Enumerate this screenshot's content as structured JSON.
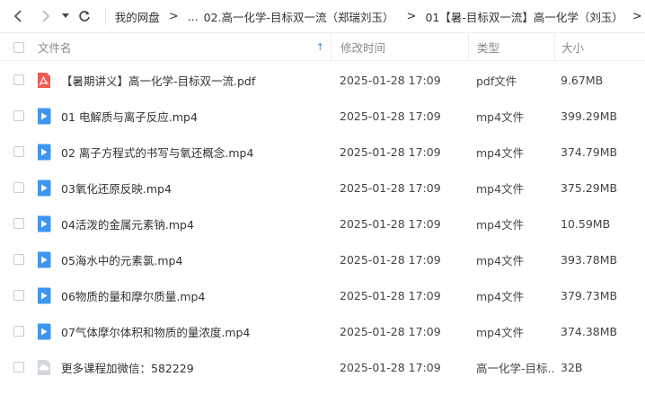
{
  "breadcrumb": [
    "我的网盘",
    "...",
    "02.高一化学-目标双一流（郑瑞刘玉）",
    "01【暑-目标双一流】高一化学（刘玉）"
  ],
  "columns": {
    "name": "文件名",
    "modified": "修改时间",
    "type": "类型",
    "size": "大小"
  },
  "files": [
    {
      "icon": "pdf-icon",
      "name": "【暑期讲义】高一化学-目标双一流.pdf",
      "modified": "2025-01-28 17:09",
      "type": "pdf文件",
      "size": "9.67MB"
    },
    {
      "icon": "video-icon",
      "name": "01 电解质与离子反应.mp4",
      "modified": "2025-01-28 17:09",
      "type": "mp4文件",
      "size": "399.29MB"
    },
    {
      "icon": "video-icon",
      "name": "02 离子方程式的书写与氧还概念.mp4",
      "modified": "2025-01-28 17:09",
      "type": "mp4文件",
      "size": "374.79MB"
    },
    {
      "icon": "video-icon",
      "name": "03氧化还原反映.mp4",
      "modified": "2025-01-28 17:09",
      "type": "mp4文件",
      "size": "375.29MB"
    },
    {
      "icon": "video-icon",
      "name": "04活泼的金属元素钠.mp4",
      "modified": "2025-01-28 17:09",
      "type": "mp4文件",
      "size": "10.59MB"
    },
    {
      "icon": "video-icon",
      "name": "05海水中的元素氯.mp4",
      "modified": "2025-01-28 17:09",
      "type": "mp4文件",
      "size": "393.78MB"
    },
    {
      "icon": "video-icon",
      "name": "06物质的量和摩尔质量.mp4",
      "modified": "2025-01-28 17:09",
      "type": "mp4文件",
      "size": "379.73MB"
    },
    {
      "icon": "video-icon",
      "name": "07气体摩尔体积和物质的量浓度.mp4",
      "modified": "2025-01-28 17:09",
      "type": "mp4文件",
      "size": "374.38MB"
    },
    {
      "icon": "generic-file-icon",
      "name": "更多课程加微信：582229",
      "modified": "2025-01-28 17:09",
      "type": "高一化学-目标...",
      "size": "32B"
    }
  ],
  "colors": {
    "accent": "#3a8ee6",
    "video": "#3b97f0",
    "pdf": "#ef5a4f",
    "generic": "#c7ccd4"
  }
}
